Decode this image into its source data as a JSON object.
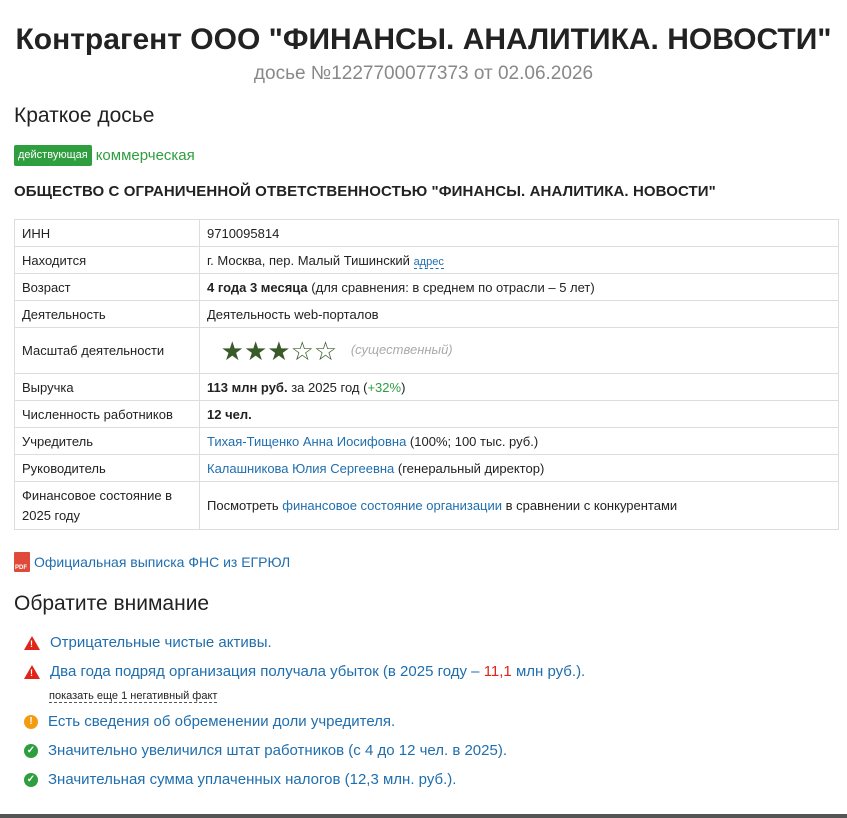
{
  "header": {
    "title_prefix": "Контрагент",
    "title_name": "ООО \"ФИНАНСЫ. АНАЛИТИКА. НОВОСТИ\"",
    "subtitle": "досье №1227700077373 от 02.06.2026"
  },
  "brief": {
    "heading": "Краткое досье",
    "status_badge": "действующая",
    "status_type": "коммерческая",
    "full_name": "ОБЩЕСТВО С ОГРАНИЧЕННОЙ ОТВЕТСТВЕННОСТЬЮ \"ФИНАНСЫ. АНАЛИТИКА. НОВОСТИ\""
  },
  "table": {
    "inn_label": "ИНН",
    "inn_value": "9710095814",
    "location_label": "Находится",
    "location_value": "г. Москва, пер. Малый Тишинский",
    "location_link": "адрес",
    "age_label": "Возраст",
    "age_value": "4 года 3 месяца",
    "age_note": " (для сравнения: в среднем по отрасли – 5 лет)",
    "activity_label": "Деятельность",
    "activity_value": "Деятельность web-порталов",
    "scale_label": "Масштаб деятельности",
    "scale_stars": 3,
    "scale_max": 5,
    "scale_note": "(существенный)",
    "revenue_label": "Выручка",
    "revenue_value": "113 млн руб.",
    "revenue_year": " за 2025 год (",
    "revenue_growth": "+32%",
    "revenue_close": ")",
    "staff_label": "Численность работников",
    "staff_value": "12 чел.",
    "founder_label": "Учредитель",
    "founder_name": "Тихая-Тищенко Анна Иосифовна",
    "founder_note": " (100%; 100 тыс. руб.)",
    "head_label": "Руководитель",
    "head_name": "Калашникова Юлия Сергеевна",
    "head_note": " (генеральный директор)",
    "finance_label": "Финансовое состояние в 2025 году",
    "finance_prefix": "Посмотреть ",
    "finance_link": "финансовое состояние организации",
    "finance_suffix": " в сравнении с конкурентами"
  },
  "extract": {
    "icon": "pdf-icon",
    "label": "Официальная выписка ФНС из ЕГРЮЛ"
  },
  "attention": {
    "heading": "Обратите внимание",
    "note1": "Отрицательные чистые активы.",
    "note2_prefix": "Два года подряд организация получала убыток (в 2025 году – ",
    "note2_value": "11,1",
    "note2_suffix": " млн руб.).",
    "more_link": "показать еще 1 негативный факт",
    "note3": "Есть сведения об обременении доли учредителя.",
    "note4": "Значительно увеличился штат работников (с 4 до 12 чел. в 2025).",
    "note5": "Значительная сумма уплаченных налогов (12,3 млн. руб.)."
  },
  "colors": {
    "accent_green": "#2e9e3e",
    "link_blue": "#1f6eae",
    "warn_red": "#e2231a",
    "warn_orange": "#f39c12",
    "star_green": "#3a5a2a"
  }
}
